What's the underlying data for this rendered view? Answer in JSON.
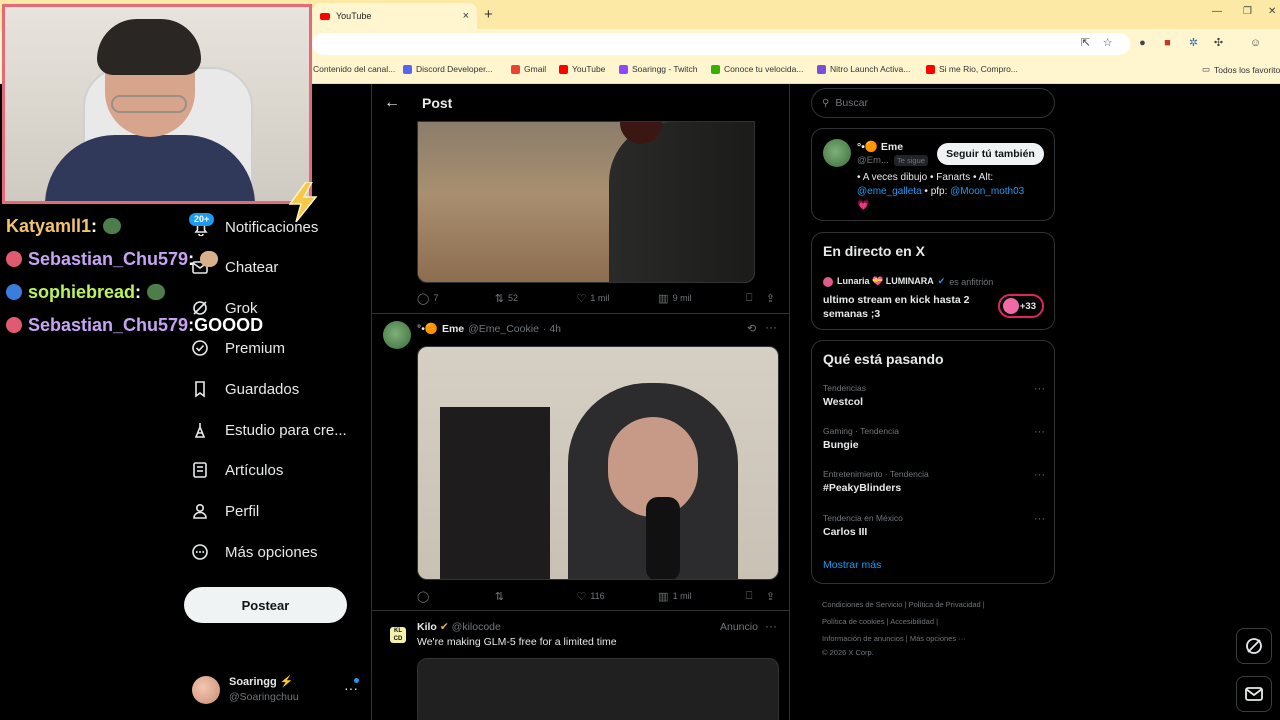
{
  "browser": {
    "tab_title": "YouTube",
    "tab_close": "×",
    "new_tab": "+",
    "bookmarks": [
      {
        "label": "Contenido del canal...",
        "color": "#ff0000"
      },
      {
        "label": "Discord Developer...",
        "color": "#5865f2"
      },
      {
        "label": "Gmail",
        "color": "#ea4335"
      },
      {
        "label": "YouTube",
        "color": "#ff0000"
      },
      {
        "label": "Soaringg - Twitch",
        "color": "#9146ff"
      },
      {
        "label": "Conoce tu velocida...",
        "color": "#38b000"
      },
      {
        "label": "Nitro Launch Activa...",
        "color": "#7b4fd8"
      },
      {
        "label": "Si me Rio, Compro...",
        "color": "#ff0000"
      }
    ],
    "bookmarks_folder": "Todos los favoritos"
  },
  "chat": [
    {
      "user": "Katyamll1",
      "sep": " :",
      "text": "",
      "color": "#f4c36b",
      "badge_color": "",
      "emote_color": "#4c7d4a"
    },
    {
      "user": "Sebastian_Chu579",
      "sep": " :",
      "text": "",
      "color": "#c7a3f5",
      "badge_color": "#e05a70",
      "emote_color": "#d9b08c"
    },
    {
      "user": "sophiebread",
      "sep": " :",
      "text": "",
      "color": "#b9f35f",
      "badge_color": "#3b7ddd",
      "emote_color": "#4c7d4a"
    },
    {
      "user": "Sebastian_Chu579",
      "sep": " :",
      "text": " GOOOD",
      "color": "#c7a3f5",
      "badge_color": "#e05a70",
      "emote_color": ""
    }
  ],
  "nav": {
    "notif_badge": "20+",
    "items": [
      {
        "label": "Notificaciones",
        "icon": "bell-icon"
      },
      {
        "label": "Chatear",
        "icon": "mail-icon"
      },
      {
        "label": "Grok",
        "icon": "grok-icon"
      },
      {
        "label": "Premium",
        "icon": "verified-icon"
      },
      {
        "label": "Guardados",
        "icon": "bookmark-icon"
      },
      {
        "label": "Estudio para cre...",
        "icon": "creator-icon"
      },
      {
        "label": "Artículos",
        "icon": "article-icon"
      },
      {
        "label": "Perfil",
        "icon": "person-icon"
      },
      {
        "label": "Más opciones",
        "icon": "more-circle-icon"
      }
    ],
    "post_button": "Postear"
  },
  "account": {
    "name": "Soaringg ⚡",
    "handle": "@Soaringchuu",
    "more": "···"
  },
  "main": {
    "header_title": "Post",
    "back_icon": "←",
    "tweet1_actions": {
      "replies": "7",
      "retweets": "52",
      "likes": "1 mil",
      "views": "9 mil"
    },
    "tweet2": {
      "emoji_prefix": "°•🟠",
      "name": "Eme",
      "handle": "@Eme_Cookie",
      "time": "· 4h",
      "actions": {
        "replies": "",
        "retweets": "",
        "likes": "116",
        "views": "1 mil"
      }
    },
    "ad": {
      "name": "Kilo",
      "handle": "@kilocode",
      "label": "Anuncio",
      "text": "We're making GLM-5 free for a limited time",
      "logo_text": "KL CD"
    }
  },
  "right": {
    "search_placeholder": "Buscar",
    "who": {
      "name": "°•🟠 Eme",
      "handle": "@Em...",
      "follows_you": "Te sigue",
      "follow_button": "Seguir tú también",
      "bio_1": "• A veces dibujo • Fanarts • Alt:",
      "bio_link1": "@eme_galleta",
      "bio_2": " • pfp: ",
      "bio_link2": "@Moon_moth03",
      "bio_heart": "💗"
    },
    "live": {
      "heading": "En directo en X",
      "host_name": "Lunaria 💝 LUMINARA",
      "host_role": "es anfitrión",
      "title": "ultimo stream en kick hasta 2 semanas ;3",
      "count": "+33"
    },
    "trends": {
      "heading": "Qué está pasando",
      "items": [
        {
          "category": "Tendencias",
          "name": "Westcol"
        },
        {
          "category": "Gaming · Tendencia",
          "name": "Bungie"
        },
        {
          "category": "Entretenimiento · Tendencia",
          "name": "#PeakyBlinders"
        },
        {
          "category": "Tendencia en México",
          "name": "Carlos III"
        }
      ],
      "more": "Mostrar más"
    },
    "footer": [
      "Condiciones de Servicio  |  Política de Privacidad  |",
      "Política de cookies  |  Accesibilidad  |",
      "Información de anuncios  |  Más opciones ···",
      "© 2026 X Corp."
    ]
  }
}
